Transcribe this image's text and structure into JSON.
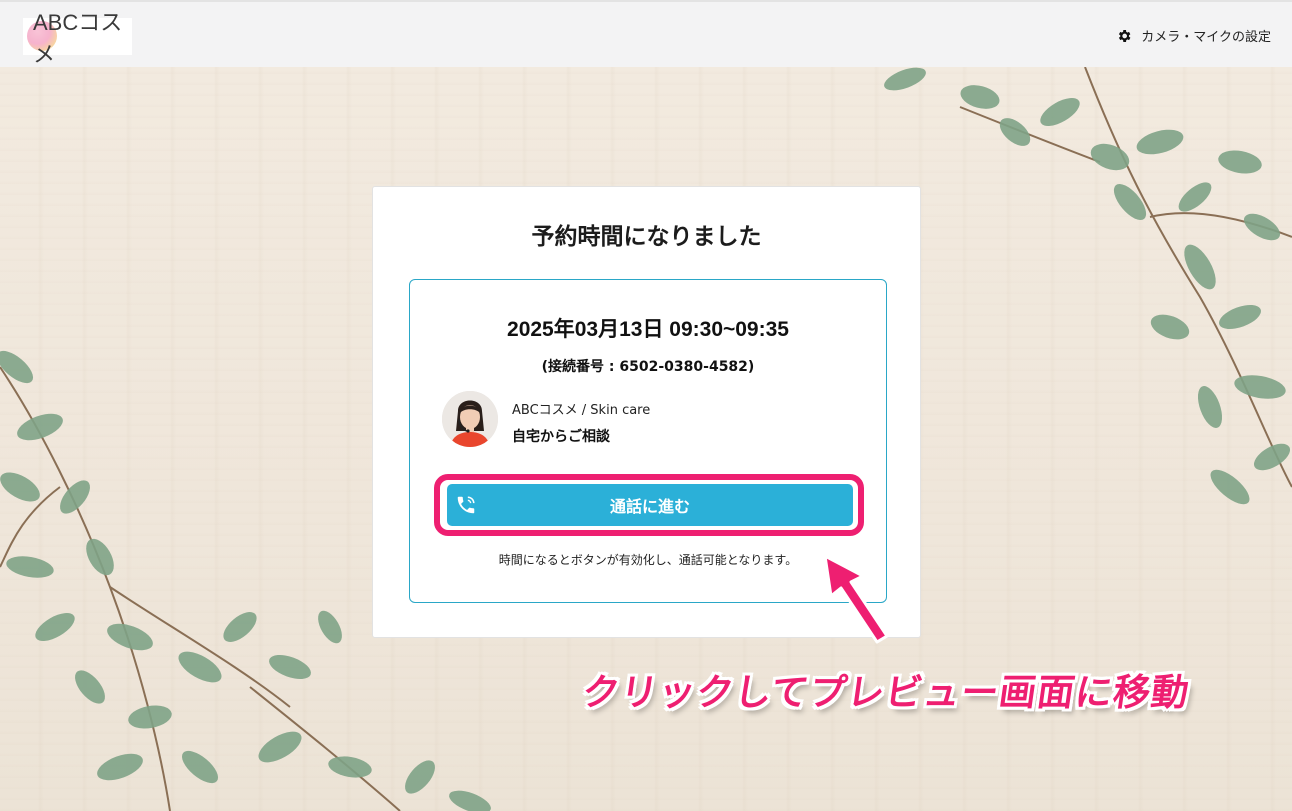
{
  "header": {
    "logo_text": "ABCコスメ",
    "settings_label": "カメラ・マイクの設定",
    "settings_icon": "gear-icon"
  },
  "card": {
    "title": "予約時間になりました",
    "datetime": "2025年03月13日 09:30~09:35",
    "connection_number": "(接続番号 : 6502-0380-4582)",
    "shop": "ABCコスメ / Skin care",
    "plan": "自宅からご相談",
    "call_button": {
      "label": "通話に進む",
      "icon": "phone-icon"
    },
    "note": "時間になるとボタンが有効化し、通話可能となります。"
  },
  "annotation": {
    "caption": "クリックしてプレビュー画面に移動",
    "color": "#ee1f71"
  },
  "colors": {
    "accent": "#2bb0d8",
    "highlight": "#ee1f71",
    "header_bg": "#f3f3f4"
  }
}
